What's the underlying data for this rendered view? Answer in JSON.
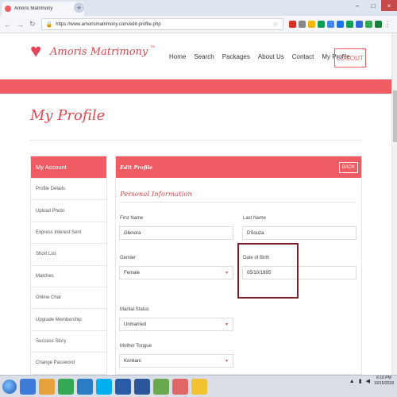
{
  "browser": {
    "tab_title": "Amoris Matrimony",
    "tab_close": "×",
    "new_tab": "+",
    "window_minimize": "–",
    "window_maximize": "□",
    "window_close": "×",
    "url": "https://www.amorismatrimony.com/edit-profile.php"
  },
  "site": {
    "logo_text": "Amoris Matrimony",
    "logo_tm": "TM",
    "nav": [
      "Home",
      "Search",
      "Packages",
      "About Us",
      "Contact",
      "My Profile"
    ],
    "logout_label": "LOGOUT",
    "accent_color": "#ef5c64"
  },
  "page": {
    "title": "My Profile"
  },
  "sidebar": {
    "heading": "My Account",
    "items": [
      "Profile Details",
      "Upload Photo",
      "Express Interest Sent",
      "Short List",
      "Matches",
      "Online Chat",
      "Upgrade Membership",
      "Success Story",
      "Change Password"
    ]
  },
  "panel": {
    "heading": "Edit Profile",
    "back_label": "BACK",
    "section_title": "Personal Information",
    "fields": {
      "first_name_label": "First Name",
      "first_name_value": "Glenora",
      "last_name_label": "Last Name",
      "last_name_value": "DSouza",
      "gender_label": "Gender",
      "gender_value": "Female",
      "dob_label": "Date of Birth",
      "dob_value": "05/10/1995",
      "marital_label": "Marital Status",
      "marital_value": "Unmarried",
      "tongue_label": "Mother Tongue",
      "tongue_value": "Konkani"
    }
  },
  "taskbar": {
    "time": "6:16 PM",
    "date": "10/15/2018"
  }
}
